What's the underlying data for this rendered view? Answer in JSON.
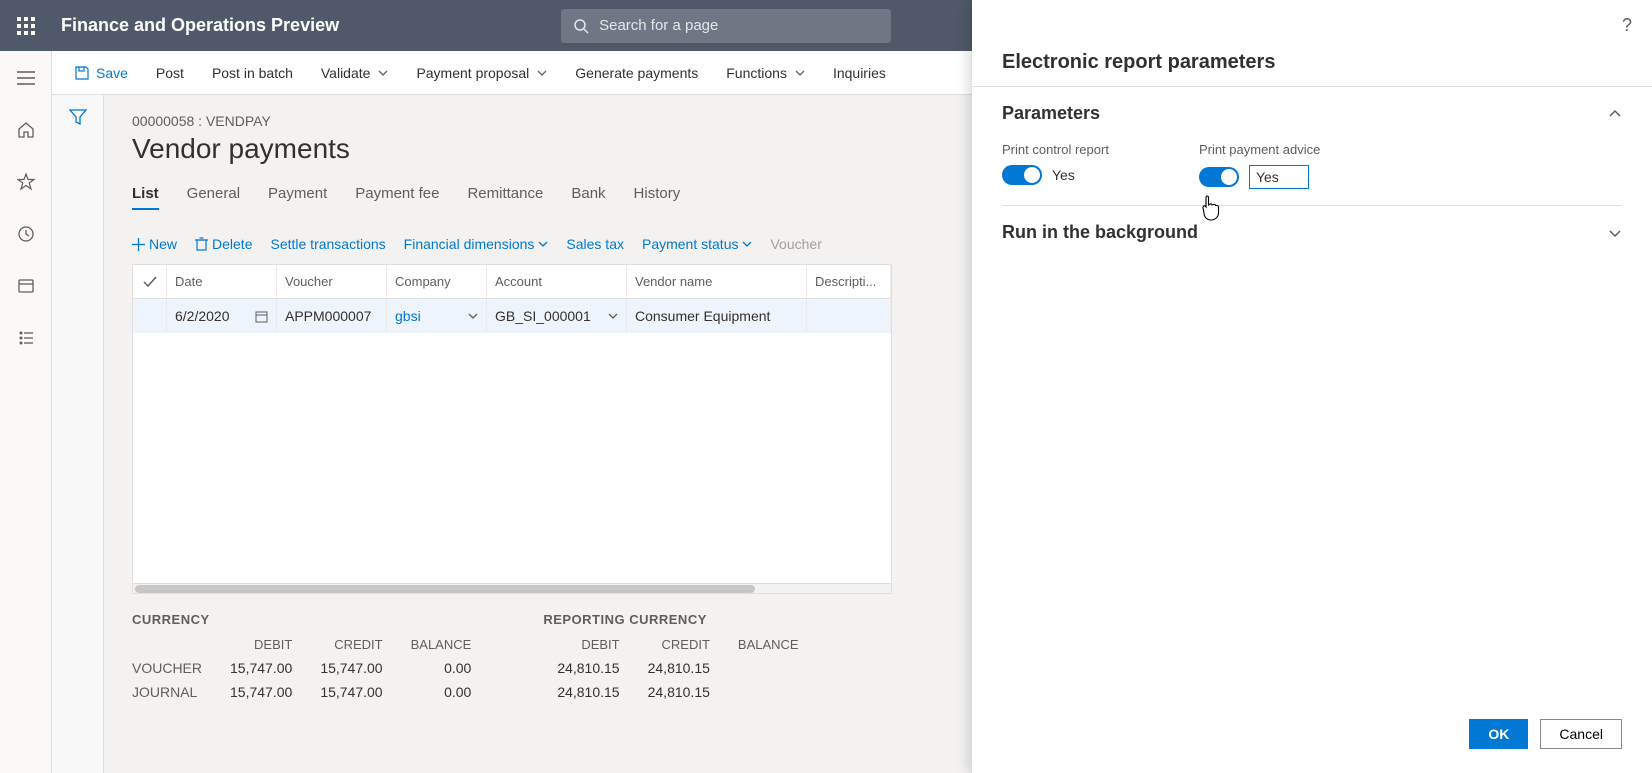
{
  "app_title": "Finance and Operations Preview",
  "search_placeholder": "Search for a page",
  "actionbar": {
    "save": "Save",
    "post": "Post",
    "post_in_batch": "Post in batch",
    "validate": "Validate",
    "payment_proposal": "Payment proposal",
    "generate_payments": "Generate payments",
    "functions": "Functions",
    "inquiries": "Inquiries"
  },
  "page": {
    "breadcrumb": "00000058 : VENDPAY",
    "title": "Vendor payments",
    "tabs": [
      "List",
      "General",
      "Payment",
      "Payment fee",
      "Remittance",
      "Bank",
      "History"
    ],
    "active_tab": "List"
  },
  "gridbar": {
    "new": "New",
    "delete": "Delete",
    "settle": "Settle transactions",
    "fin_dims": "Financial dimensions",
    "sales_tax": "Sales tax",
    "payment_status": "Payment status",
    "voucher": "Voucher"
  },
  "grid": {
    "headers": {
      "date": "Date",
      "voucher": "Voucher",
      "company": "Company",
      "account": "Account",
      "vendor": "Vendor name",
      "description": "Descripti..."
    },
    "rows": [
      {
        "date": "6/2/2020",
        "voucher": "APPM000007",
        "company": "gbsi",
        "account": "GB_SI_000001",
        "vendor": "Consumer Equipment",
        "description": ""
      }
    ]
  },
  "totals": {
    "currency_caption": "CURRENCY",
    "reporting_caption": "REPORTING CURRENCY",
    "cols": [
      "DEBIT",
      "CREDIT",
      "BALANCE"
    ],
    "rows": [
      {
        "label": "VOUCHER",
        "currency": [
          "15,747.00",
          "15,747.00",
          "0.00"
        ],
        "reporting": [
          "24,810.15",
          "24,810.15",
          ""
        ]
      },
      {
        "label": "JOURNAL",
        "currency": [
          "15,747.00",
          "15,747.00",
          "0.00"
        ],
        "reporting": [
          "24,810.15",
          "24,810.15",
          ""
        ]
      }
    ],
    "reporting_balance_header": "BALANCE"
  },
  "flyout": {
    "title": "Electronic report parameters",
    "parameters_section": "Parameters",
    "run_bg_section": "Run in the background",
    "print_control_label": "Print control report",
    "print_control_value": "Yes",
    "print_advice_label": "Print payment advice",
    "print_advice_value": "Yes",
    "ok": "OK",
    "cancel": "Cancel"
  }
}
